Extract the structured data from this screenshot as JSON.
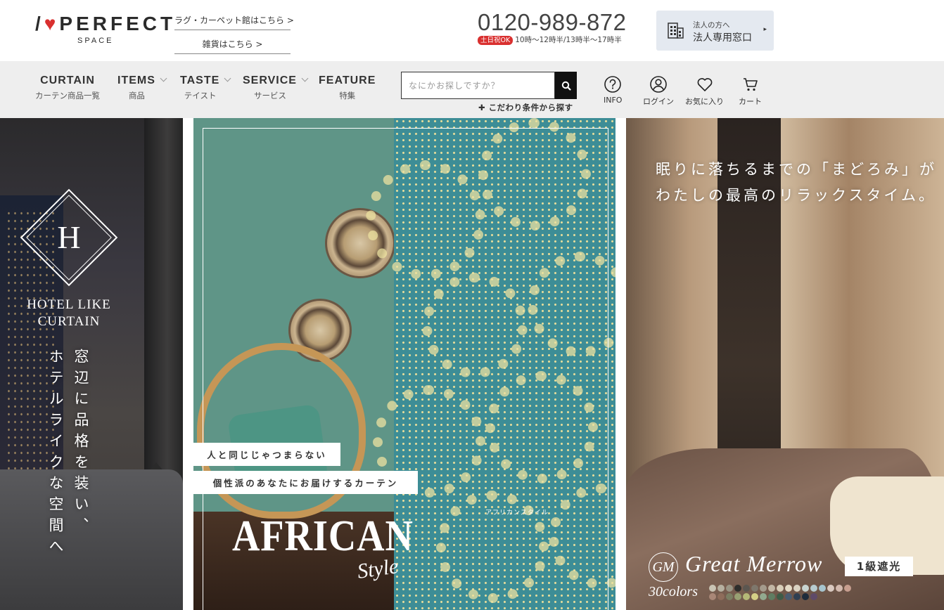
{
  "header": {
    "logo_text": "PERFECT",
    "logo_sub": "SPACE",
    "links": [
      {
        "label": "ラグ・カーペット館はこちら >"
      },
      {
        "label": "雑貨はこちら >"
      }
    ],
    "phone": {
      "number": "0120-989-872",
      "badge": "土日祝OK",
      "hours": "10時〜12時半/13時半〜17時半"
    },
    "corporate": {
      "small": "法人の方へ",
      "label": "法人専用窓口",
      "arrow": "▸"
    }
  },
  "nav": {
    "items": [
      {
        "en": "CURTAIN",
        "ja": "カーテン商品一覧"
      },
      {
        "en": "ITEMS",
        "ja": "商品"
      },
      {
        "en": "TASTE",
        "ja": "テイスト"
      },
      {
        "en": "SERVICE",
        "ja": "サービス"
      },
      {
        "en": "FEATURE",
        "ja": "特集"
      }
    ],
    "search_placeholder": "なにかお探しですか？",
    "advanced_search": "✚ こだわり条件から探す",
    "utilities": [
      {
        "label": "INFO",
        "icon": "question-circle-icon"
      },
      {
        "label": "ログイン",
        "icon": "user-icon"
      },
      {
        "label": "お気に入り",
        "icon": "heart-icon"
      },
      {
        "label": "カート",
        "icon": "cart-icon"
      }
    ]
  },
  "banners": {
    "hotel": {
      "monogram": "H",
      "brand_line1": "HOTEL LIKE",
      "brand_line2": "CURTAIN",
      "copy_col1": "窓辺に品格を装い、",
      "copy_col2": "ホテルライクな空間へ"
    },
    "african": {
      "tag1": "人と同じじゃつまらない",
      "tag2": "個性派のあなたにお届けするカーテン",
      "sub": "アフリカンスタイル",
      "title": "AFRICAN",
      "title_script": "Style"
    },
    "merrow": {
      "copy_line1": "眠りに落ちるまでの「まどろみ」が",
      "copy_line2": "わたしの最高のリラックスタイム。",
      "logo": "GM",
      "name": "Great Merrow",
      "badge": "1級遮光",
      "colors_label": "30colors",
      "swatches": [
        "#c9c4b4",
        "#b6b0a0",
        "#9a9585",
        "#2e2e2c",
        "#5b5650",
        "#7e776c",
        "#a49b8c",
        "#c2b7a5",
        "#d8ceb9",
        "#e3dac6",
        "#d9d2c2",
        "#c8d4d0",
        "#b7cbcf",
        "#a6c4cd",
        "#d9c9c0",
        "#d2b9ae",
        "#c79e8f",
        "#a98777",
        "#8e6d5b",
        "#7b7e63",
        "#98a073",
        "#b5b877",
        "#d5cf86",
        "#92a98f",
        "#5f7d62",
        "#3e5b47",
        "#4a5c70",
        "#2f3f52",
        "#1f2c3b",
        "#5f4a68"
      ]
    }
  }
}
